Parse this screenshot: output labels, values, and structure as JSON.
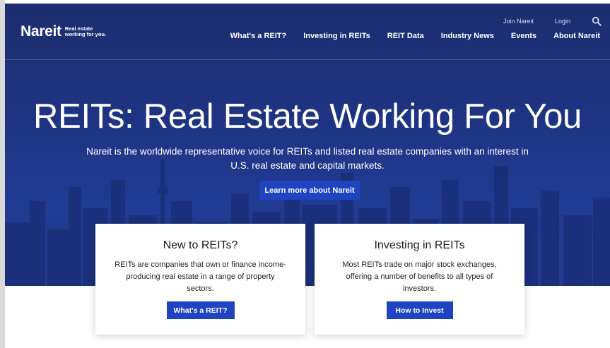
{
  "brand": {
    "name": "Nareit",
    "tagline_line1": "Real estate",
    "tagline_line2": "working for you."
  },
  "utility_nav": {
    "join": "Join Nareit",
    "login": "Login",
    "search_icon": "search-icon"
  },
  "main_nav": {
    "items": [
      {
        "label": "What's a REIT?"
      },
      {
        "label": "Investing in REITs"
      },
      {
        "label": "REIT Data"
      },
      {
        "label": "Industry News"
      },
      {
        "label": "Events"
      },
      {
        "label": "About Nareit"
      }
    ]
  },
  "hero": {
    "title": "REITs: Real Estate Working For You",
    "subtitle": "Nareit is the worldwide representative voice for REITs and listed real estate companies with an interest in U.S. real estate and capital markets.",
    "cta": "Learn more about Nareit"
  },
  "cards": [
    {
      "title": "New to REITs?",
      "text": "REITs are companies that own or finance income-producing real estate in a range of property sectors.",
      "button": "What's a REIT?"
    },
    {
      "title": "Investing in REITs",
      "text": "Most REITs trade on major stock exchanges, offering a number of benefits to all types of investors.",
      "button": "How to Invest"
    }
  ],
  "colors": {
    "hero_blue": "#1e3482",
    "button_blue": "#1e44c1"
  }
}
